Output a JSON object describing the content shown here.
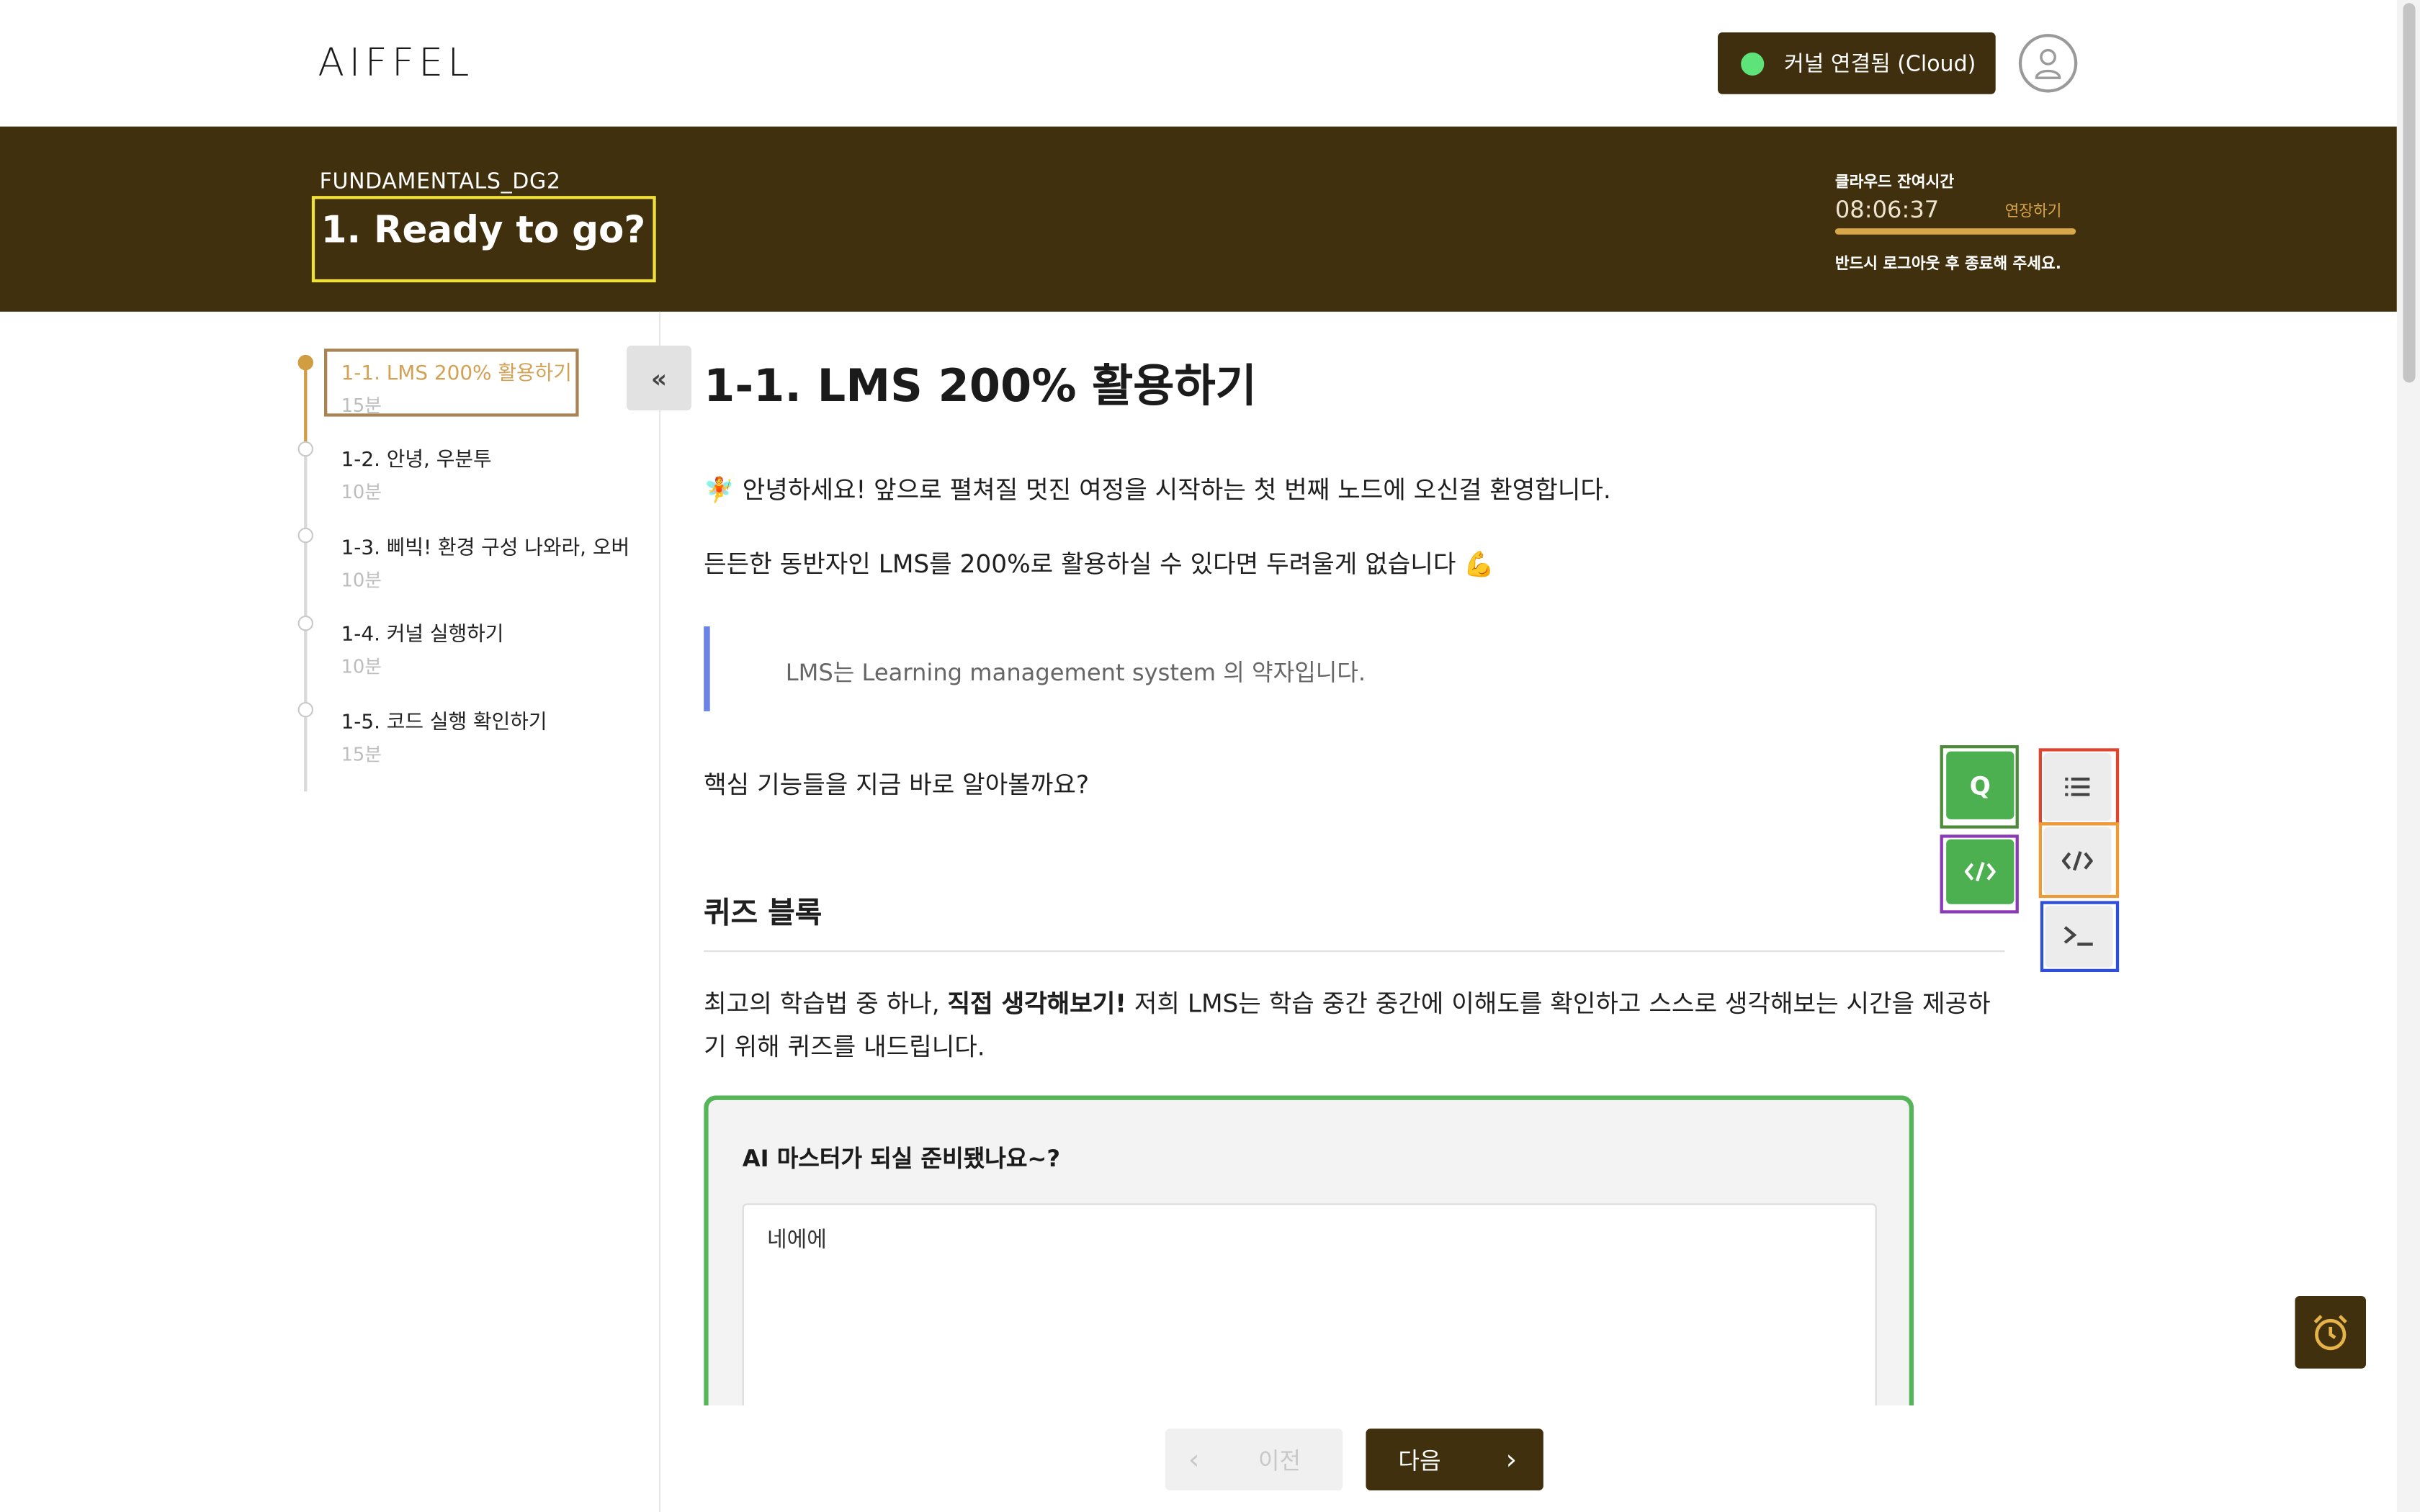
{
  "header": {
    "logo": "AIFFEL",
    "kernel_status": "커널 연결됨 (Cloud)",
    "kernel_status_color": "#5ee27a"
  },
  "banner": {
    "course_code": "FUNDAMENTALS_DG2",
    "node_title": "1. Ready to go?",
    "timer_label": "클라우드 잔여시간",
    "timer_value": "08:06:37",
    "timer_extend": "연장하기",
    "timer_note": "반드시 로그아웃 후 종료해 주세요."
  },
  "sidebar": {
    "steps": [
      {
        "title": "1-1. LMS 200% 활용하기",
        "time": "15분",
        "active": true
      },
      {
        "title": "1-2. 안녕, 우분투",
        "time": "10분",
        "active": false
      },
      {
        "title": "1-3. 삐빅! 환경 구성 나와라, 오버",
        "time": "10분",
        "active": false
      },
      {
        "title": "1-4. 커널 실행하기",
        "time": "10분",
        "active": false
      },
      {
        "title": "1-5. 코드 실행 확인하기",
        "time": "15분",
        "active": false
      }
    ]
  },
  "content": {
    "title": "1-1. LMS 200% 활용하기",
    "intro": "🧚 안녕하세요! 앞으로 펼쳐질 멋진 여정을 시작하는 첫 번째 노드에 오신걸 환영합니다.",
    "intro2": "든든한 동반자인 LMS를 200%로 활용하실 수 있다면 두려울게 없습니다 💪",
    "quote": "LMS는 Learning management system 의 약자입니다.",
    "question_lead": "핵심 기능들을 지금 바로 알아볼까요?",
    "section_heading": "퀴즈 블록",
    "section_body_pre": "최고의 학습법 중 하나,",
    "section_body_bold": "직접 생각해보기!",
    "section_body_post": "저희 LMS는 학습 중간 중간에 이해도를 확인하고 스스로 생각해보는 시간을 제공하기 위해 퀴즈를 내드립니다."
  },
  "quiz": {
    "question": "AI 마스터가 되실 준비됐나요~?",
    "answer": "네에에"
  },
  "tools": {
    "quiz_label": "Q"
  },
  "nav": {
    "prev": "이전",
    "next": "다음"
  },
  "colors": {
    "brand": "#41300d",
    "accent": "#d19d42",
    "quiz_border": "#55b559",
    "quote_bar": "#6b83e6"
  }
}
